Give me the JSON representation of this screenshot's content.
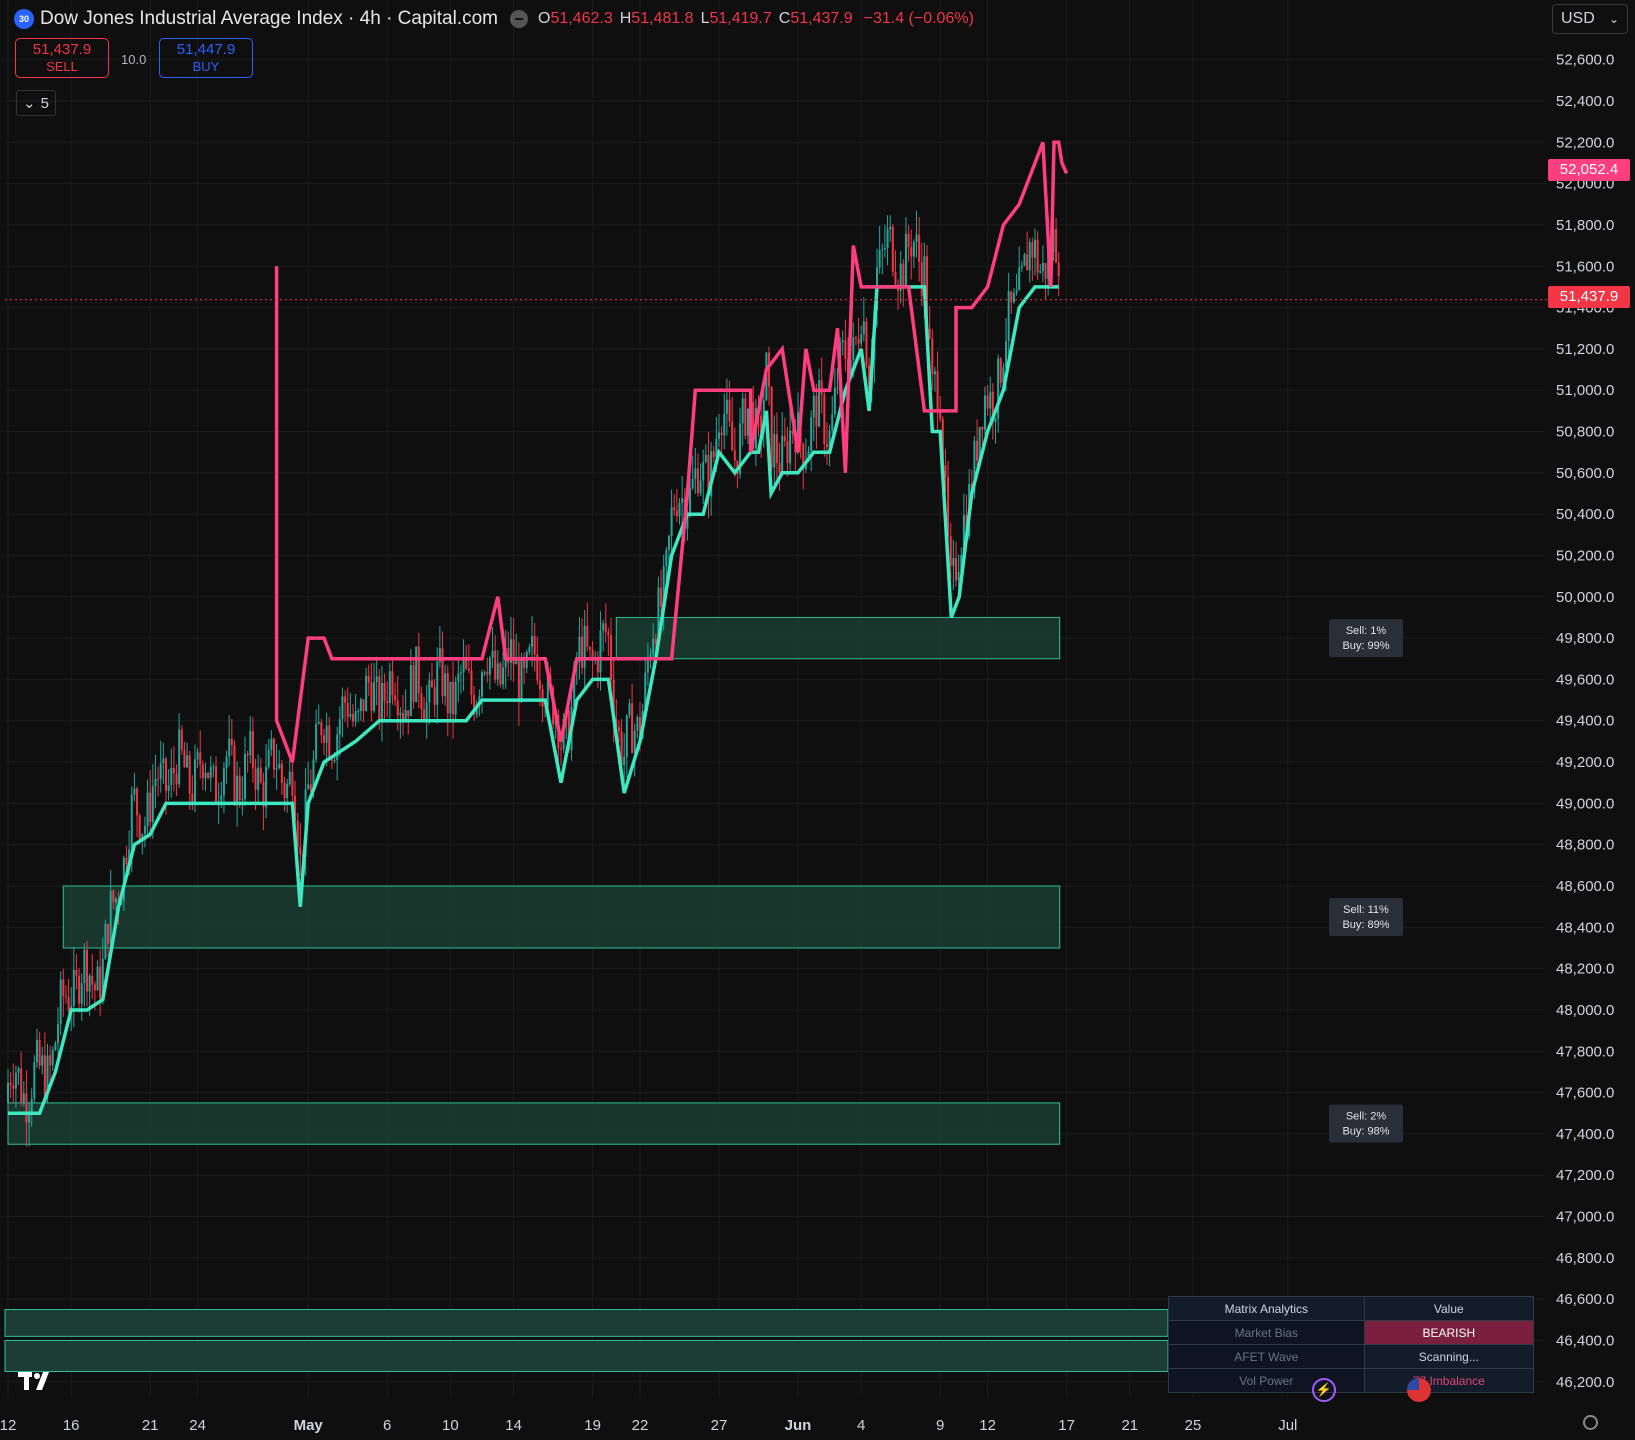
{
  "header": {
    "symbol_badge": "30",
    "title": "Dow Jones Industrial Average Index · 4h · Capital.com",
    "ohlc": {
      "o_label": "O",
      "o": "51,462.3",
      "h_label": "H",
      "h": "51,481.8",
      "l_label": "L",
      "l": "51,419.7",
      "c_label": "C",
      "c": "51,437.9",
      "change": "−31.4 (−0.06%)"
    }
  },
  "trade": {
    "sell_price": "51,437.9",
    "sell_label": "SELL",
    "spread": "10.0",
    "buy_price": "51,447.9",
    "buy_label": "BUY"
  },
  "indicators_toggle": {
    "count": "5"
  },
  "currency": "USD",
  "price_tags": {
    "upper_line": "52,052.4",
    "last_price": "51,437.9"
  },
  "matrix": {
    "col1": "Matrix Analytics",
    "col2": "Value",
    "rows": [
      {
        "name": "Market Bias",
        "value": "BEARISH"
      },
      {
        "name": "AFET Wave",
        "value": "Scanning..."
      },
      {
        "name": "Vol Power",
        "value": "77 Imbalance"
      }
    ]
  },
  "colors": {
    "background": "#0f0f0f",
    "bull": "#26a69a",
    "bear": "#f23645",
    "support_line": "#3de8c0",
    "resistance_line": "#ff3e7f",
    "zone_fill": "#1b3d33",
    "zone_border": "#2fbf97"
  },
  "chart_data": {
    "type": "line",
    "title": "Dow Jones Industrial Average Index · 4h · Capital.com",
    "ylim": [
      46100,
      52700
    ],
    "y_ticks": [
      "52,600.0",
      "52,400.0",
      "52,200.0",
      "52,000.0",
      "51,800.0",
      "51,600.0",
      "51,400.0",
      "51,200.0",
      "51,000.0",
      "50,800.0",
      "50,600.0",
      "50,400.0",
      "50,200.0",
      "50,000.0",
      "49,800.0",
      "49,600.0",
      "49,400.0",
      "49,200.0",
      "49,000.0",
      "48,800.0",
      "48,600.0",
      "48,400.0",
      "48,200.0",
      "48,000.0",
      "47,800.0",
      "47,600.0",
      "47,400.0",
      "47,200.0",
      "47,000.0",
      "46,800.0",
      "46,600.0",
      "46,400.0",
      "46,200.0"
    ],
    "x_ticks": [
      {
        "label": "12",
        "day": 0
      },
      {
        "label": "16",
        "day": 4
      },
      {
        "label": "21",
        "day": 9
      },
      {
        "label": "24",
        "day": 12
      },
      {
        "label": "May",
        "day": 19
      },
      {
        "label": "6",
        "day": 24
      },
      {
        "label": "10",
        "day": 28
      },
      {
        "label": "14",
        "day": 32
      },
      {
        "label": "19",
        "day": 37
      },
      {
        "label": "22",
        "day": 40
      },
      {
        "label": "27",
        "day": 45
      },
      {
        "label": "Jun",
        "day": 50
      },
      {
        "label": "4",
        "day": 54
      },
      {
        "label": "9",
        "day": 59
      },
      {
        "label": "12",
        "day": 62
      },
      {
        "label": "17",
        "day": 67
      },
      {
        "label": "21",
        "day": 71
      },
      {
        "label": "25",
        "day": 75
      },
      {
        "label": "Jul",
        "day": 81
      }
    ],
    "grid": true,
    "last_price": 51437.9,
    "series": [],
    "support_path": [
      [
        0,
        47500
      ],
      [
        2,
        47500
      ],
      [
        3,
        47700
      ],
      [
        4,
        48000
      ],
      [
        5,
        48000
      ],
      [
        6,
        48050
      ],
      [
        7,
        48500
      ],
      [
        8,
        48800
      ],
      [
        9,
        48850
      ],
      [
        10,
        49000
      ],
      [
        18,
        49000
      ],
      [
        18.5,
        48500
      ],
      [
        19,
        49000
      ],
      [
        20,
        49200
      ],
      [
        22,
        49300
      ],
      [
        23.5,
        49400
      ],
      [
        29,
        49400
      ],
      [
        30,
        49500
      ],
      [
        32,
        49500
      ],
      [
        34,
        49500
      ],
      [
        35,
        49100
      ],
      [
        36,
        49500
      ],
      [
        37,
        49600
      ],
      [
        38,
        49600
      ],
      [
        39,
        49050
      ],
      [
        40,
        49300
      ],
      [
        41,
        49700
      ],
      [
        42,
        50200
      ],
      [
        43,
        50400
      ],
      [
        44,
        50400
      ],
      [
        45,
        50700
      ],
      [
        46,
        50600
      ],
      [
        47,
        50700
      ],
      [
        47.5,
        50700
      ],
      [
        48,
        50900
      ],
      [
        48.3,
        50500
      ],
      [
        49,
        50600
      ],
      [
        50,
        50600
      ],
      [
        51,
        50700
      ],
      [
        52,
        50700
      ],
      [
        53,
        51000
      ],
      [
        54,
        51200
      ],
      [
        54.5,
        50900
      ],
      [
        55,
        51500
      ],
      [
        56,
        51500
      ],
      [
        57,
        51500
      ],
      [
        58,
        51500
      ],
      [
        58.5,
        50800
      ],
      [
        59,
        50800
      ],
      [
        59.7,
        49900
      ],
      [
        60.2,
        50000
      ],
      [
        61,
        50500
      ],
      [
        62,
        50800
      ],
      [
        63,
        51000
      ],
      [
        64,
        51400
      ],
      [
        65,
        51500
      ],
      [
        66.5,
        51500
      ]
    ],
    "resistance_path": [
      [
        17,
        51600
      ],
      [
        17,
        49400
      ],
      [
        18,
        49200
      ],
      [
        19,
        49800
      ],
      [
        20,
        49800
      ],
      [
        20.5,
        49700
      ],
      [
        22,
        49700
      ],
      [
        23,
        49700
      ],
      [
        30,
        49700
      ],
      [
        31,
        50000
      ],
      [
        31.5,
        49700
      ],
      [
        34,
        49700
      ],
      [
        35,
        49300
      ],
      [
        36,
        49700
      ],
      [
        38,
        49700
      ],
      [
        42,
        49700
      ],
      [
        43,
        50500
      ],
      [
        43.5,
        51000
      ],
      [
        47,
        51000
      ],
      [
        47,
        50700
      ],
      [
        48,
        51100
      ],
      [
        49,
        51200
      ],
      [
        50,
        50700
      ],
      [
        50.5,
        51200
      ],
      [
        51,
        51000
      ],
      [
        52,
        51000
      ],
      [
        52.5,
        51300
      ],
      [
        53,
        50600
      ],
      [
        53.5,
        51700
      ],
      [
        54,
        51500
      ],
      [
        57,
        51500
      ],
      [
        58,
        50900
      ],
      [
        59,
        50900
      ],
      [
        60,
        50900
      ],
      [
        60,
        51400
      ],
      [
        61,
        51400
      ],
      [
        62,
        51500
      ],
      [
        63,
        51800
      ],
      [
        64,
        51900
      ],
      [
        65,
        52100
      ],
      [
        65.5,
        52200
      ],
      [
        66,
        51500
      ],
      [
        66.2,
        52200
      ],
      [
        66.5,
        52200
      ],
      [
        66.7,
        52100
      ],
      [
        67,
        52050
      ]
    ],
    "zones": [
      {
        "start_day": 38.5,
        "top": 49900,
        "bottom": 49700,
        "sell": "Sell: 1%",
        "buy": "Buy: 99%"
      },
      {
        "start_day": 3.5,
        "top": 48600,
        "bottom": 48300,
        "sell": "Sell: 11%",
        "buy": "Buy: 89%"
      },
      {
        "start_day": 0,
        "top": 47550,
        "bottom": 47350,
        "sell": "Sell: 2%",
        "buy": "Buy: 98%"
      }
    ]
  }
}
